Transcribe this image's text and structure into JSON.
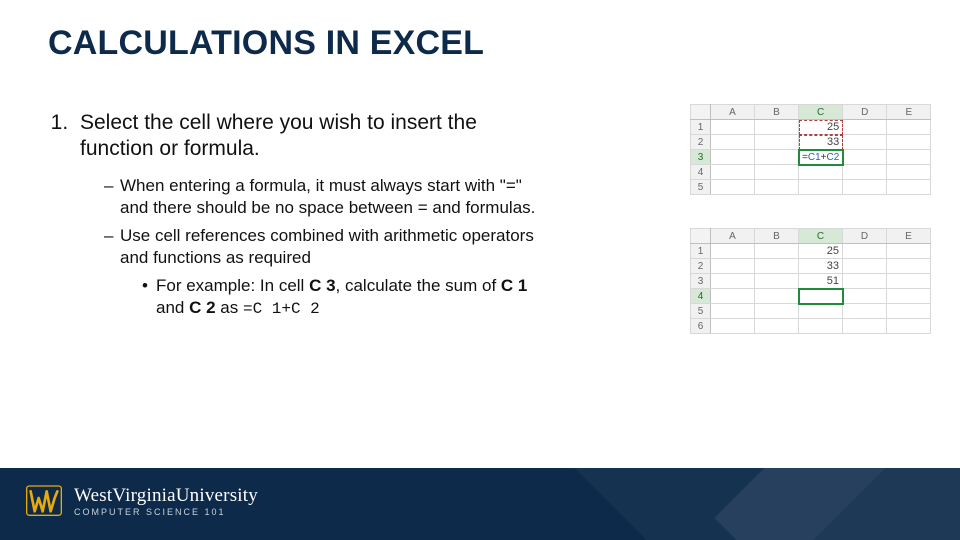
{
  "title": "CALCULATIONS IN EXCEL",
  "list": {
    "item1": "Select the cell where you wish to insert the function or formula.",
    "sub1": "When entering a formula, it must always start with \"=\" and there should be no space between = and formulas.",
    "sub2": "Use cell references combined with arithmetic operators and functions as required",
    "example_prefix": "For example: In cell ",
    "example_cell": "C 3",
    "example_mid": ", calculate the sum of ",
    "example_a": "C 1",
    "example_and": " and ",
    "example_b": "C 2",
    "example_as": " as ",
    "example_formula": "=C 1+C 2"
  },
  "excel1": {
    "cols": [
      "A",
      "B",
      "C",
      "D",
      "E"
    ],
    "rows": [
      "1",
      "2",
      "3",
      "4",
      "5"
    ],
    "c1": "25",
    "c2": "33",
    "formula_eq": "=",
    "formula_r1": "C1",
    "formula_plus": "+",
    "formula_r2": "C2",
    "sel_col": "C",
    "sel_row": "3"
  },
  "excel2": {
    "cols": [
      "A",
      "B",
      "C",
      "D",
      "E"
    ],
    "rows": [
      "1",
      "2",
      "3",
      "4",
      "5",
      "6"
    ],
    "c1": "25",
    "c2": "33",
    "c3": "51",
    "sel_col": "C",
    "sel_row": "4"
  },
  "footer": {
    "univ": "WestVirginiaUniversity",
    "course": "COMPUTER SCIENCE 101"
  },
  "colors": {
    "heading": "#0d2a4a",
    "accent": "#e8a90c",
    "footer_bg": "#0d2a4a",
    "excel_sel": "#1f8b3b"
  }
}
